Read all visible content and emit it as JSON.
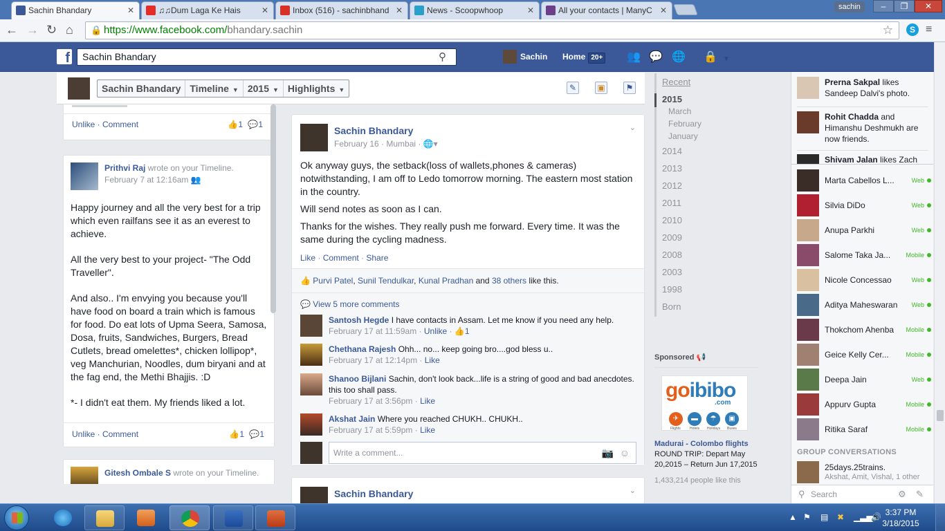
{
  "browser": {
    "tabs": [
      {
        "title": "Sachin Bhandary",
        "color": "#3b5998",
        "active": true
      },
      {
        "title": "♫♫Dum Laga Ke Hais",
        "color": "#e52d27"
      },
      {
        "title": "Inbox (516) - sachinbhand",
        "color": "#d93025"
      },
      {
        "title": "News - Scoopwhoop",
        "color": "#2aa0c9"
      },
      {
        "title": "All your contacts | ManyC",
        "color": "#6b3f8a"
      }
    ],
    "profile_badge": "sachin",
    "url_host": "https://www.facebook.com/",
    "url_path": "bhandary.sachin"
  },
  "fb_top": {
    "search_value": "Sachin Bhandary",
    "user_name": "Sachin",
    "home_label": "Home",
    "home_count": "20+"
  },
  "timeline_header": {
    "name": "Sachin Bhandary",
    "section": "Timeline",
    "year": "2015",
    "filter": "Highlights"
  },
  "left_posts": {
    "top_actions": "Unlike · Comment",
    "top_likes": "1",
    "top_comments": "1",
    "post2": {
      "author": "Prithvi Raj",
      "action": " wrote on your Timeline.",
      "time": "February 7 at 12:16am",
      "p1": "Happy journey and all the very best for a trip which even railfans see it as an everest to achieve.",
      "p2": "All the very best to your project- \"The Odd Traveller\".",
      "p3": "And also.. I'm envying you because you'll have food on board a train which is famous for food. Do eat lots of Upma Seera, Samosa, Dosa, fruits, Sandwiches, Burgers, Bread Cutlets, bread omelettes*, chicken lollipop*, veg Manchurian, Noodles, dum biryani and at the fag end, the Methi Bhajjis. :D",
      "p4": "*- I didn't eat them. My friends liked a lot.",
      "actions": "Unlike · Comment",
      "likes": "1",
      "comments": "1"
    },
    "post3": {
      "author": "Gitesh Ombale S",
      "action": " wrote on your Timeline."
    }
  },
  "main_post": {
    "author": "Sachin Bhandary",
    "meta": "February 16 · Mumbai ·",
    "p1": "Ok anyway guys, the setback(loss of wallets,phones & cameras) notwithstanding, I am off to Ledo tomorrow morning. The eastern most station in the country.",
    "p2": "Will send notes as soon as I can.",
    "p3": "Thanks for the wishes. They really push me forward. Every time. It was the same during the cycling madness.",
    "actions": {
      "like": "Like",
      "comment": "Comment",
      "share": "Share"
    },
    "likers": {
      "a": "Purvi Patel",
      "b": "Sunil Tendulkar",
      "c": "Kunal Pradhan",
      "and": " and ",
      "others": "38 others",
      "tail": " like this."
    },
    "view_more": "View 5 more comments",
    "comments": [
      {
        "name": "Santosh Hegde",
        "text": "I have contacts in Assam. Let me know if you need any help.",
        "time": "February 17 at 11:59am",
        "action": "Unlike",
        "likes": "1"
      },
      {
        "name": "Chethana Rajesh",
        "text": "Ohh... no... keep going bro....god bless u..",
        "time": "February 17 at 12:14pm",
        "action": "Like"
      },
      {
        "name": "Shanoo Bijlani",
        "text": "Sachin, don't look back...life is a string of good and bad anecdotes. this too shall pass.",
        "time": "February 17 at 3:56pm",
        "action": "Like"
      },
      {
        "name": "Akshat Jain",
        "text": "Where you reached CHUKH.. CHUKH..",
        "time": "February 17 at 5:59pm",
        "action": "Like"
      }
    ],
    "comment_placeholder": "Write a comment..."
  },
  "next_post": {
    "author": "Sachin Bhandary"
  },
  "years_nav": {
    "recent": "Recent",
    "current": "2015",
    "months": [
      "March",
      "February",
      "January"
    ],
    "years": [
      "2014",
      "2013",
      "2012",
      "2011",
      "2010",
      "2009",
      "2008",
      "2003",
      "1998",
      "Born"
    ]
  },
  "sponsored": {
    "header": "Sponsored",
    "logo_a": "go",
    "logo_b": "ibibo",
    "logo_com": ".com",
    "categories": [
      "Flights",
      "Hotels",
      "Holidays",
      "Buses"
    ],
    "title": "Madurai - Colombo flights",
    "body": "ROUND TRIP: Depart May 20,2015 – Return Jun 17,2015",
    "likes": "1,433,214 people like this"
  },
  "ticker": [
    {
      "name": "Prerna Sakpal",
      "text": " likes Sandeep Dalvi's photo."
    },
    {
      "name": "Rohit Chadda",
      "text": " and Himanshu Deshmukh are now friends."
    },
    {
      "name": "Shivam Jalan",
      "text": " likes Zach"
    }
  ],
  "chat": [
    {
      "name": "Marta Cabellos L...",
      "status": "Web"
    },
    {
      "name": "Silvia DiDo",
      "status": "Web"
    },
    {
      "name": "Anupa Parkhi",
      "status": "Web"
    },
    {
      "name": "Salome Taka Ja...",
      "status": "Mobile"
    },
    {
      "name": "Nicole Concessao",
      "status": "Web"
    },
    {
      "name": "Aditya Maheswaran",
      "status": "Web"
    },
    {
      "name": "Thokchom Ahenba",
      "status": "Mobile"
    },
    {
      "name": "Geice Kelly Cer...",
      "status": "Mobile"
    },
    {
      "name": "Deepa Jain",
      "status": "Web"
    },
    {
      "name": "Appurv Gupta",
      "status": "Mobile"
    },
    {
      "name": "Ritika Saraf",
      "status": "Mobile"
    }
  ],
  "group_conv": {
    "header": "GROUP CONVERSATIONS",
    "name": "25days.25trains.",
    "members": "Akshat, Amit, Vishal, 1 other"
  },
  "chat_search_placeholder": "Search",
  "taskbar": {
    "time": "3:37 PM",
    "date": "3/18/2015"
  }
}
